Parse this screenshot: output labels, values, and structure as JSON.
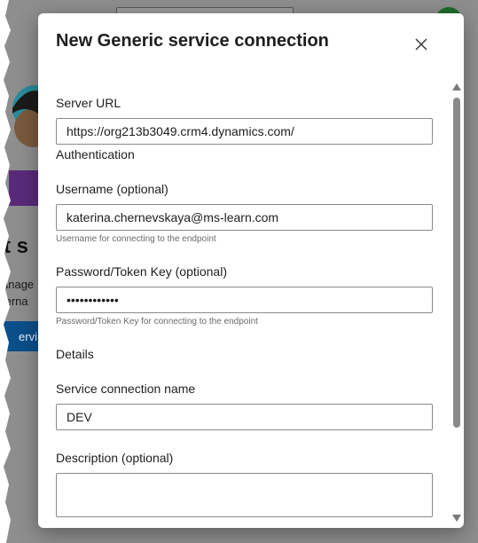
{
  "dialog": {
    "title": "New Generic service connection",
    "close_icon": "close-icon"
  },
  "fields": {
    "server_url": {
      "label": "Server URL",
      "value": "https://org213b3049.crm4.dynamics.com/"
    },
    "authentication_section": "Authentication",
    "username": {
      "label": "Username (optional)",
      "value": "katerina.chernevskaya@ms-learn.com",
      "hint": "Username for connecting to the endpoint"
    },
    "password": {
      "label": "Password/Token Key (optional)",
      "value": "••••••••••••",
      "hint": "Password/Token Key for connecting to the endpoint"
    },
    "details_section": "Details",
    "connection_name": {
      "label": "Service connection name",
      "value": "DEV"
    },
    "description": {
      "label": "Description (optional)",
      "value": ""
    }
  },
  "background": {
    "title_fragment": "t s",
    "line1": "anage",
    "line2": "terna",
    "button_fragment": "ervi"
  },
  "colors": {
    "overlay": "#8e8e8e",
    "dialog_bg": "#ffffff",
    "input_border": "#8a8a8a",
    "text": "#1e1e1e",
    "hint_text": "#6b6b6b",
    "bg_button": "#0b4f8a"
  }
}
